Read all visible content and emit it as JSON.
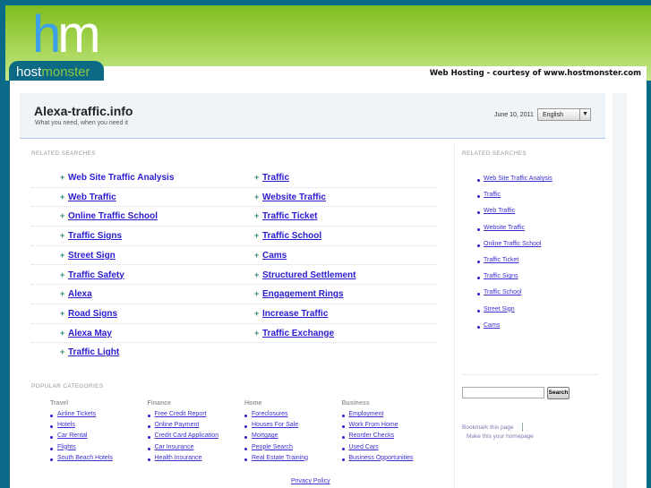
{
  "banner": {
    "brand_h": "h",
    "brand_m": "m",
    "brand_host": "host",
    "brand_monster": "monster",
    "tagline": "Web Hosting - courtesy of www.hostmonster.com"
  },
  "header": {
    "title": "Alexa-traffic.info",
    "subtitle": "What you need, when you need it",
    "date": "June 10, 2011",
    "language": "English"
  },
  "main": {
    "related_label": "RELATED SEARCHES",
    "rows": [
      [
        "Web Site Traffic Analysis",
        "Traffic"
      ],
      [
        "Web Traffic",
        "Website Traffic"
      ],
      [
        "Online Traffic School",
        "Traffic Ticket"
      ],
      [
        "Traffic Signs",
        "Traffic School"
      ],
      [
        "Street Sign",
        "Cams"
      ],
      [
        "Traffic Safety",
        "Structured Settlement"
      ],
      [
        "Alexa",
        "Engagement Rings"
      ],
      [
        "Road Signs",
        "Increase Traffic"
      ],
      [
        "Alexa May",
        "Traffic Exchange"
      ],
      [
        "Traffic Light",
        null
      ]
    ],
    "popular_label": "POPULAR CATEGORIES",
    "categories": [
      {
        "name": "Travel",
        "items": [
          "Airline Tickets",
          "Hotels",
          "Car Rental",
          "Flights",
          "South Beach Hotels"
        ]
      },
      {
        "name": "Finance",
        "items": [
          "Free Credit Report",
          "Online Payment",
          "Credit Card Application",
          "Car Insurance",
          "Health Insurance"
        ]
      },
      {
        "name": "Home",
        "items": [
          "Foreclosures",
          "Houses For Sale",
          "Mortgage",
          "People Search",
          "Real Estate Training"
        ]
      },
      {
        "name": "Business",
        "items": [
          "Employment",
          "Work From Home",
          "Reorder Checks",
          "Used Cars",
          "Business Opportunities"
        ]
      }
    ],
    "privacy": "Privacy Policy"
  },
  "sidebar": {
    "related_label": "RELATED SEARCHES",
    "items": [
      "Web Site Traffic Analysis",
      "Traffic",
      "Web Traffic",
      "Website Traffic",
      "Online Traffic School",
      "Traffic Ticket",
      "Traffic Signs",
      "Traffic School",
      "Street Sign",
      "Cams"
    ],
    "search_button": "Search",
    "search_value": "",
    "bookmark": "Bookmark this page",
    "homepage": "Make this your homepage"
  }
}
